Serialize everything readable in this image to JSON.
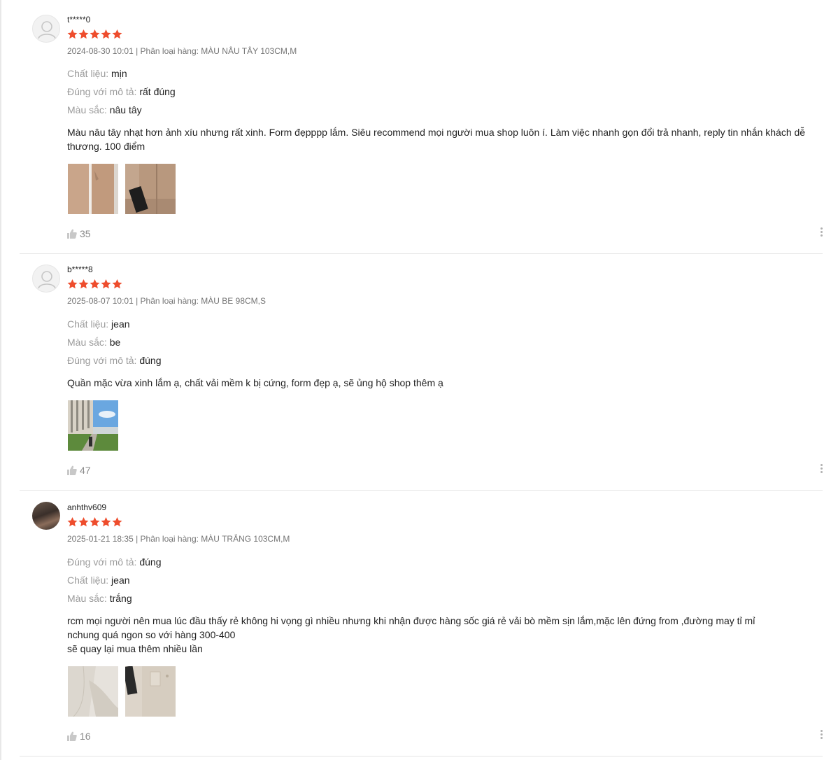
{
  "colors": {
    "star": "#ee4d2d",
    "muted": "#757575",
    "label": "#9b9b9b"
  },
  "reviews": [
    {
      "username": "t*****0",
      "rating": 5,
      "date": "2024-08-30 10:01",
      "variant_prefix": "Phân loại hàng:",
      "variant": "MÀU NÂU TÂY 103CM,M",
      "attrs": [
        {
          "key": "Chất liệu:",
          "value": "mịn"
        },
        {
          "key": "Đúng với mô tả:",
          "value": "rất đúng"
        },
        {
          "key": "Màu sắc:",
          "value": "nâu tây"
        }
      ],
      "text_lines": [
        "Màu nâu tây nhạt hơn ảnh xíu nhưng rất xinh. Form đẹpppp lắm. Siêu recommend mọi người mua shop luôn í. Làm việc nhanh gọn đổi trả nhanh, reply tin nhắn khách dễ",
        "thương. 100 điểm"
      ],
      "likes": "35"
    },
    {
      "username": "b*****8",
      "rating": 5,
      "date": "2025-08-07 10:01",
      "variant_prefix": "Phân loại hàng:",
      "variant": "MÀU BE 98CM,S",
      "attrs": [
        {
          "key": "Chất liệu:",
          "value": "jean"
        },
        {
          "key": "Màu sắc:",
          "value": "be"
        },
        {
          "key": "Đúng với mô tả:",
          "value": "đúng"
        }
      ],
      "text_lines": [
        "Quần mặc vừa xinh lắm ạ, chất vải mềm k bị cứng, form đẹp ạ, sẽ ủng hộ shop thêm ạ"
      ],
      "likes": "47"
    },
    {
      "username": "anhthv609",
      "rating": 5,
      "date": "2025-01-21 18:35",
      "variant_prefix": "Phân loại hàng:",
      "variant": "MÀU TRẮNG 103CM,M",
      "attrs": [
        {
          "key": "Đúng với mô tả:",
          "value": "đúng"
        },
        {
          "key": "Chất liệu:",
          "value": "jean"
        },
        {
          "key": "Màu sắc:",
          "value": "trắng"
        }
      ],
      "text_lines": [
        "rcm mọi người nên mua lúc đầu thấy rẻ không hi vọng gì nhiều nhưng khi nhận được hàng sốc giá rẻ vải bò mềm sịn lắm,mặc lên đứng from ,đường may tỉ mỉ",
        "nchung quá ngon so với hàng 300-400",
        "sẽ quay lại mua thêm nhiều lần"
      ],
      "likes": "16"
    }
  ]
}
